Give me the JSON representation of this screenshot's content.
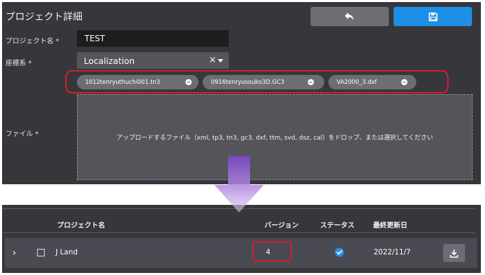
{
  "header": {
    "title": "プロジェクト詳細",
    "back_icon": "undo-icon",
    "save_icon": "save-icon"
  },
  "form": {
    "project_name_label": "プロジェクト名 *",
    "project_name_value": "TEST",
    "crs_label": "座標系 *",
    "crs_value": "Localization",
    "crs_clear": "×",
    "file_label": "ファイル *",
    "files": [
      "1012tenryuthuchi001.tn3",
      "0916tenryusouko3D.GC3",
      "VA2000_3.dxf"
    ],
    "dropzone_text": "アップロードするファイル（xml, tp3, tn3, gc3, dxf, ttm, svd, dsz, cal）をドロップ、または選択してください"
  },
  "table": {
    "headers": {
      "name": "プロジェクト名",
      "version": "バージョン",
      "status": "ステータス",
      "updated": "最終更新日"
    },
    "rows": [
      {
        "chevron": "›",
        "name": "J Land",
        "version": "4",
        "updated": "2022/11/7"
      }
    ]
  },
  "colors": {
    "panel": "#37373b",
    "accent": "#1e8fe6",
    "highlight": "#d81d2b",
    "arrow": "#b489e0"
  }
}
